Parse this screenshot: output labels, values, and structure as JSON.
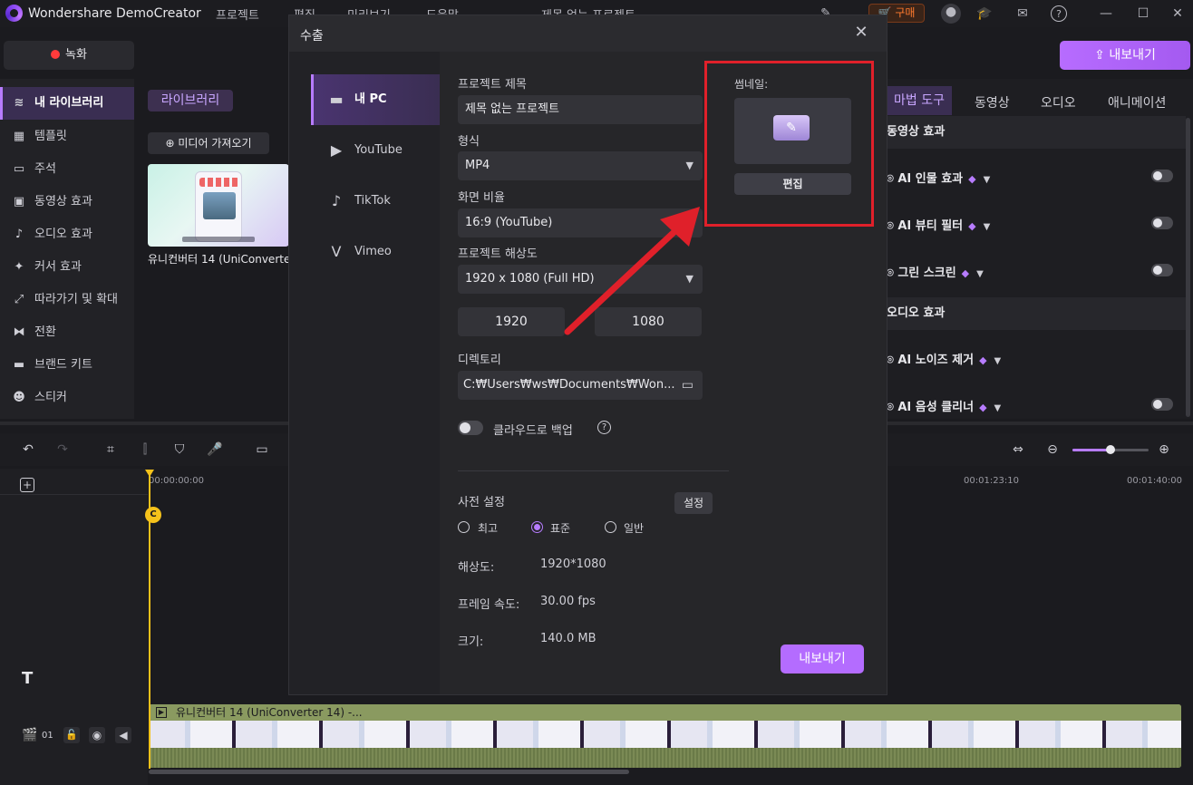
{
  "app": {
    "title": "Wondershare DemoCreator",
    "menu": [
      "프로젝트",
      "편집",
      "미리보기",
      "도움말"
    ],
    "project_name": "제목 없는 프로젝트",
    "buy_label": "구매"
  },
  "toolbar": {
    "record_label": "녹화",
    "export_label": "내보내기"
  },
  "sidebar": {
    "items": [
      {
        "label": "내 라이브러리",
        "icon": "layers-icon"
      },
      {
        "label": "템플릿",
        "icon": "template-icon"
      },
      {
        "label": "주석",
        "icon": "annotation-icon"
      },
      {
        "label": "동영상 효과",
        "icon": "video-effect-icon"
      },
      {
        "label": "오디오 효과",
        "icon": "audio-effect-icon"
      },
      {
        "label": "커서 효과",
        "icon": "cursor-effect-icon"
      },
      {
        "label": "따라가기 및 확대",
        "icon": "zoom-pan-icon"
      },
      {
        "label": "전환",
        "icon": "transition-icon"
      },
      {
        "label": "브랜드 키트",
        "icon": "brand-kit-icon"
      },
      {
        "label": "스티커",
        "icon": "sticker-icon"
      }
    ]
  },
  "library": {
    "tag": "라이브러리",
    "import_label": "미디어 가져오기",
    "clip_name": "유니컨버터 14 (UniConverte..."
  },
  "right_panel": {
    "tabs": [
      "마법 도구",
      "동영상",
      "오디오",
      "애니메이션"
    ],
    "video_section": "동영상 효과",
    "video_items": [
      "AI 인물 효과",
      "AI 뷰티 필터",
      "그린 스크린"
    ],
    "audio_section": "오디오 효과",
    "audio_items": [
      "AI 노이즈 제거",
      "AI 음성 클리너"
    ]
  },
  "timeline": {
    "ruler": [
      "00:00:00:00",
      "00:01:23:10",
      "00:01:40:00"
    ],
    "track_label": "01",
    "clip_title": "유니컨버터 14 (UniConverter 14) -...",
    "zoom_level": 0.5
  },
  "export_dialog": {
    "title": "수출",
    "destinations": [
      "내 PC",
      "YouTube",
      "TikTok",
      "Vimeo"
    ],
    "project_title_label": "프로젝트 제목",
    "project_title_value": "제목 없는 프로젝트",
    "format_label": "형식",
    "format_value": "MP4",
    "aspect_label": "화면 비율",
    "aspect_value": "16:9 (YouTube)",
    "resolution_label": "프로젝트 해상도",
    "resolution_value": "1920 x 1080 (Full HD)",
    "width": "1920",
    "height": "1080",
    "directory_label": "디렉토리",
    "directory_value": "C:₩Users₩ws₩Documents₩Won...",
    "cloud_backup_label": "클라우드로 백업",
    "preset_label": "사전 설정",
    "settings_label": "설정",
    "presets": [
      "최고",
      "표준",
      "일반"
    ],
    "selected_preset": "표준",
    "info": [
      {
        "label": "해상도:",
        "value": "1920*1080"
      },
      {
        "label": "프레임 속도:",
        "value": "30.00 fps"
      },
      {
        "label": "크기:",
        "value": "140.0 MB"
      }
    ],
    "thumbnail_label": "썸네일:",
    "edit_label": "편집",
    "export_label": "내보내기"
  },
  "colors": {
    "accent": "#b77cff",
    "highlight": "#e0202a",
    "playhead": "#f5c21b"
  }
}
